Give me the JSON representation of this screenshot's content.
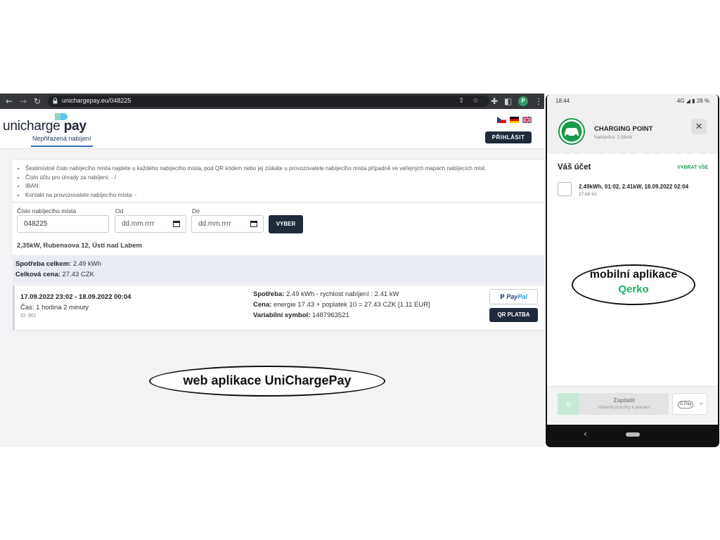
{
  "browser": {
    "url": "unichargepay.eu/048225",
    "profile_initial": "P"
  },
  "site": {
    "logo_prefix": "unicharge",
    "logo_suffix": "pay",
    "tab_label": "Nepřiřazená nabíjení",
    "login_label": "PŘIHLÁSIT",
    "languages": [
      "cs",
      "de",
      "en"
    ]
  },
  "info": {
    "items": [
      "Šestimístné číslo nabíjecího místa najdete u každého nabíjecího místa, pod QR kódem nebo jej získáte u provozovatele nabíjecího místa případně ve veřejných mapách nabíjecích míst.",
      "Číslo účtu pro úhrady za nabíjení: - /",
      "IBAN:",
      "Kontakt na provozovatele nabíjecího místa: -"
    ]
  },
  "form": {
    "station_label": "Číslo nabíjecího místa",
    "station_value": "048225",
    "from_label": "Od",
    "from_placeholder": "dd.mm.rrrr",
    "to_label": "Do",
    "to_placeholder": "dd.mm.rrrr",
    "filter_label": "VYBER"
  },
  "station": {
    "address": "2,35kW, Rubensova 12, Ústí nad Labem"
  },
  "totals": {
    "consumption_label": "Spotřeba celkem:",
    "consumption_value": "2.49 kWh",
    "price_label": "Celková cena:",
    "price_value": "27.43 CZK"
  },
  "session": {
    "period": "17.09.2022 23:02 - 18.09.2022 00:04",
    "duration": "Čas: 1 hodina 2 minuty",
    "id": "ID: 952",
    "consumption_label": "Spotřeba:",
    "consumption_value": "2.49 kWh - rychlost nabíjení : 2.41 kW",
    "price_label": "Cena:",
    "price_value": "energie 17.43 + poplatek 10 = 27.43 CZK [1.11 EUR]",
    "vs_label": "Variabilní symbol:",
    "vs_value": "1487963521",
    "paypal_part1": "Pay",
    "paypal_part2": "Pal",
    "qr_label": "QR PLATBA"
  },
  "annotations": {
    "web": "web aplikace UniChargePay",
    "mobile_title": "mobilní aplikace",
    "mobile_brand": "Qerko"
  },
  "phone": {
    "time": "18:44",
    "status_right": "4G ◢ ▮ 28 %",
    "title": "CHARGING POINT",
    "subtitle": "Nabíječka: 2,35kW",
    "account_title": "Váš účet",
    "select_all": "VYBRAT VŠE",
    "item_title": "2.49kWh, 01:02, 2.41kW, 18.09.2022 02:04",
    "item_price": "27,68 Kč",
    "pay_label": "Zaplatit",
    "pay_hint": "Vyberte položky k placení",
    "gpay_label": "G Pay"
  },
  "colors": {
    "dark_button": "#1f2a3a",
    "accent_green": "#20b26b",
    "totals_bg": "#e9ecf5"
  }
}
